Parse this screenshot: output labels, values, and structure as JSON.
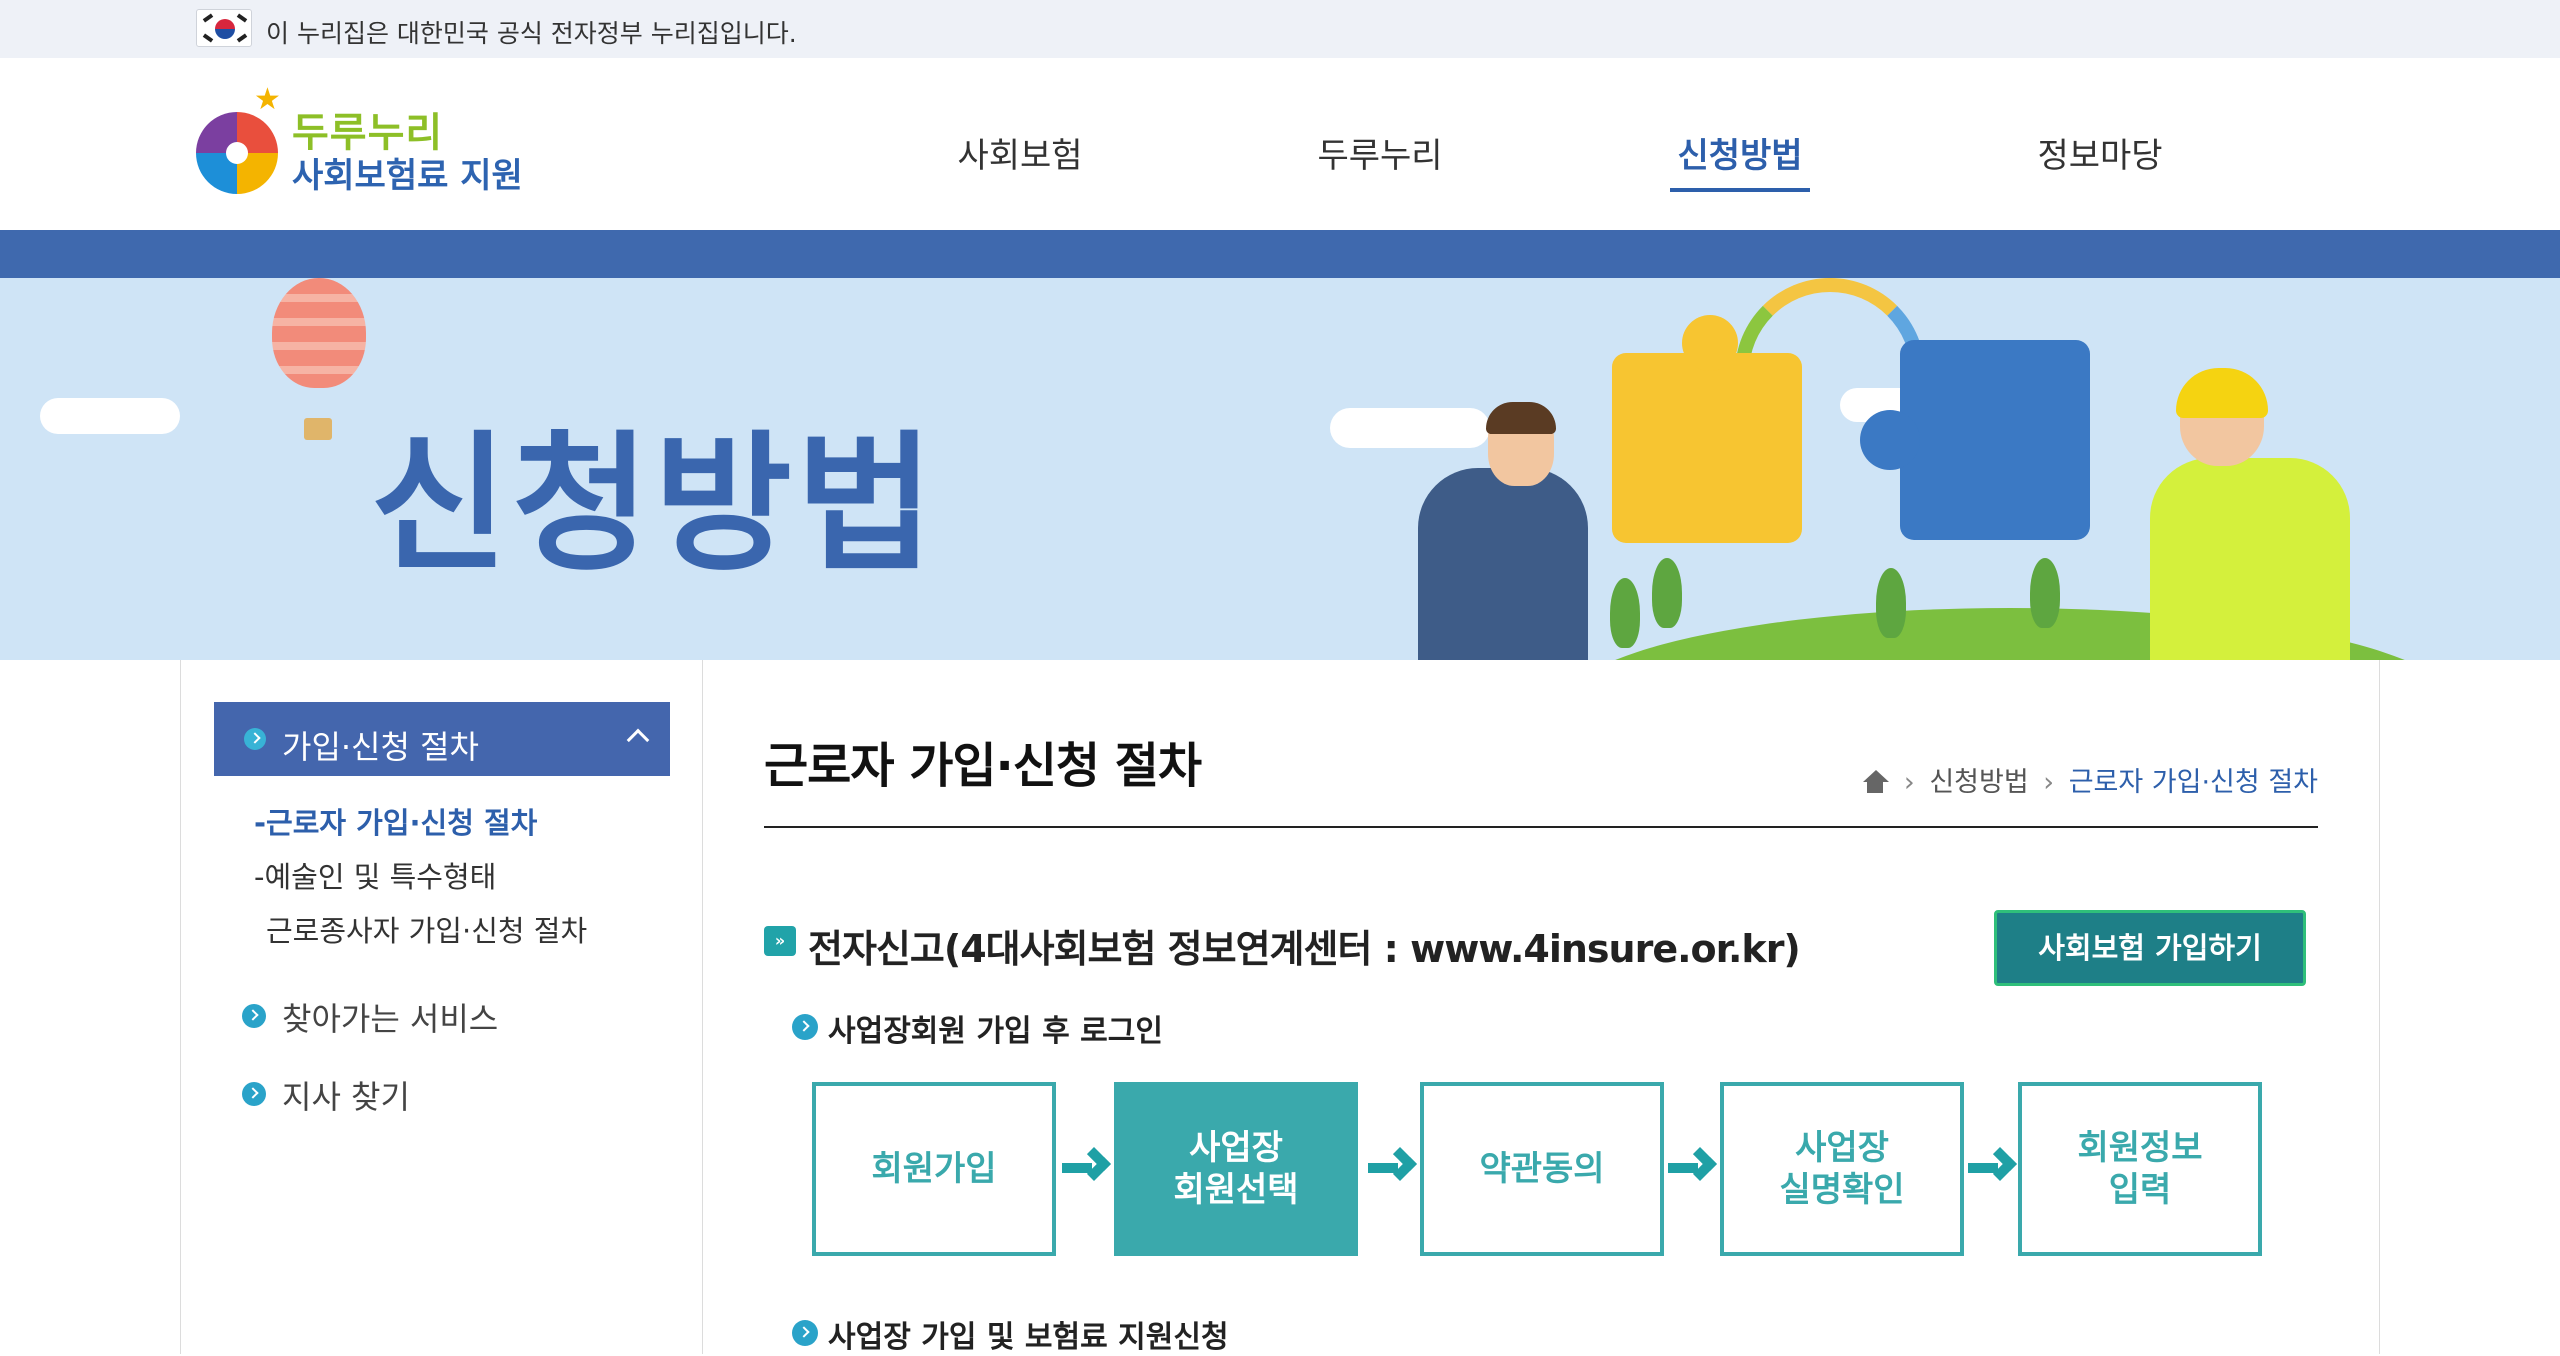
{
  "gov_banner": {
    "text": "이 누리집은 대한민국 공식 전자정부 누리집입니다.",
    "icon": "korea-flag-icon"
  },
  "logo": {
    "line1": "두루누리",
    "line2": "사회보험료 지원"
  },
  "gnb": [
    {
      "label": "사회보험",
      "active": false
    },
    {
      "label": "두루누리",
      "active": false
    },
    {
      "label": "신청방법",
      "active": true
    },
    {
      "label": "정보마당",
      "active": false
    }
  ],
  "hero": {
    "title": "신청방법"
  },
  "lnb": {
    "head": "가입·신청 절차",
    "sub_items": [
      {
        "label": "-근로자 가입·신청 절차",
        "active": true
      },
      {
        "label": "-예술인 및 특수형태",
        "active": false
      },
      {
        "label": "근로종사자 가입·신청 절차",
        "active": false
      }
    ],
    "items": [
      "찾아가는 서비스",
      "지사 찾기"
    ]
  },
  "main": {
    "title": "근로자 가입·신청 절차",
    "breadcrumb": [
      "신청방법",
      "근로자 가입·신청 절차"
    ],
    "section_title": "전자신고(4대사회보험 정보연계센터 : www.4insure.or.kr)",
    "join_button": "사회보험 가입하기",
    "subheads": [
      "사업장회원 가입 후 로그인",
      "사업장 가입 및 보험료 지원신청"
    ],
    "steps": [
      {
        "label": "회원가입",
        "highlight": false
      },
      {
        "label": "사업장\n회원선택",
        "highlight": true
      },
      {
        "label": "약관동의",
        "highlight": false
      },
      {
        "label": "사업장\n실명확인",
        "highlight": false
      },
      {
        "label": "회원정보\n입력",
        "highlight": false
      }
    ]
  }
}
